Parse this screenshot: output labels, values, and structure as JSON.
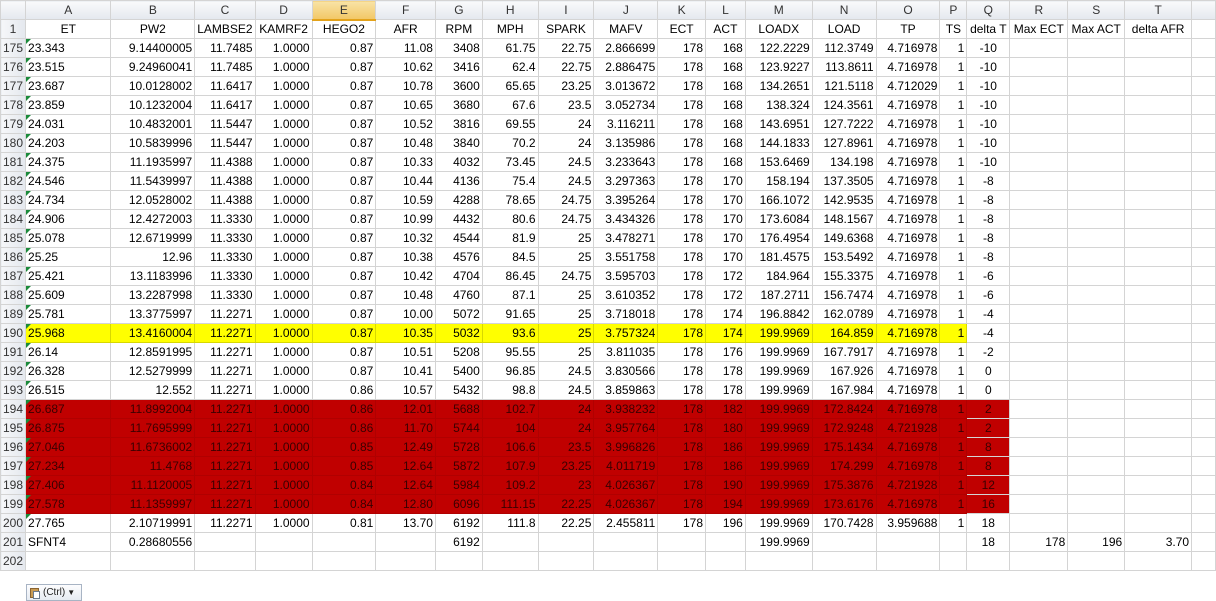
{
  "columns": [
    {
      "letter": "A",
      "header": "ET",
      "w": 86
    },
    {
      "letter": "B",
      "header": "PW2",
      "w": 84
    },
    {
      "letter": "C",
      "header": "LAMBSE2",
      "w": 60
    },
    {
      "letter": "D",
      "header": "KAMRF2",
      "w": 57
    },
    {
      "letter": "E",
      "header": "HEGO2",
      "w": 64
    },
    {
      "letter": "F",
      "header": "AFR",
      "w": 60
    },
    {
      "letter": "G",
      "header": "RPM",
      "w": 47
    },
    {
      "letter": "H",
      "header": "MPH",
      "w": 56
    },
    {
      "letter": "I",
      "header": "SPARK",
      "w": 56
    },
    {
      "letter": "J",
      "header": "MAFV",
      "w": 64
    },
    {
      "letter": "K",
      "header": "ECT",
      "w": 48
    },
    {
      "letter": "L",
      "header": "ACT",
      "w": 40
    },
    {
      "letter": "M",
      "header": "LOADX",
      "w": 67
    },
    {
      "letter": "N",
      "header": "LOAD",
      "w": 64
    },
    {
      "letter": "O",
      "header": "TP",
      "w": 64
    },
    {
      "letter": "P",
      "header": "TS",
      "w": 27
    },
    {
      "letter": "Q",
      "header": "delta T",
      "w": 43
    },
    {
      "letter": "R",
      "header": "Max ECT",
      "w": 58
    },
    {
      "letter": "S",
      "header": "Max ACT",
      "w": 57
    },
    {
      "letter": "T",
      "header": "delta AFR",
      "w": 67
    },
    {
      "letter": "",
      "header": "",
      "w": 24
    }
  ],
  "active_column": "E",
  "rows": [
    {
      "n": "175",
      "style": "",
      "cells": [
        "23.343",
        "9.14400005",
        "11.7485",
        "1.0000",
        "0.87",
        "11.08",
        "3408",
        "61.75",
        "22.75",
        "2.866699",
        "178",
        "168",
        "122.2229",
        "112.3749",
        "4.716978",
        "1",
        "-10",
        "",
        "",
        ""
      ]
    },
    {
      "n": "176",
      "style": "",
      "cells": [
        "23.515",
        "9.24960041",
        "11.7485",
        "1.0000",
        "0.87",
        "10.62",
        "3416",
        "62.4",
        "22.75",
        "2.886475",
        "178",
        "168",
        "123.9227",
        "113.8611",
        "4.716978",
        "1",
        "-10",
        "",
        "",
        ""
      ]
    },
    {
      "n": "177",
      "style": "",
      "cells": [
        "23.687",
        "10.0128002",
        "11.6417",
        "1.0000",
        "0.87",
        "10.78",
        "3600",
        "65.65",
        "23.25",
        "3.013672",
        "178",
        "168",
        "134.2651",
        "121.5118",
        "4.712029",
        "1",
        "-10",
        "",
        "",
        ""
      ]
    },
    {
      "n": "178",
      "style": "",
      "cells": [
        "23.859",
        "10.1232004",
        "11.6417",
        "1.0000",
        "0.87",
        "10.65",
        "3680",
        "67.6",
        "23.5",
        "3.052734",
        "178",
        "168",
        "138.324",
        "124.3561",
        "4.716978",
        "1",
        "-10",
        "",
        "",
        ""
      ]
    },
    {
      "n": "179",
      "style": "",
      "cells": [
        "24.031",
        "10.4832001",
        "11.5447",
        "1.0000",
        "0.87",
        "10.52",
        "3816",
        "69.55",
        "24",
        "3.116211",
        "178",
        "168",
        "143.6951",
        "127.7222",
        "4.716978",
        "1",
        "-10",
        "",
        "",
        ""
      ]
    },
    {
      "n": "180",
      "style": "",
      "cells": [
        "24.203",
        "10.5839996",
        "11.5447",
        "1.0000",
        "0.87",
        "10.48",
        "3840",
        "70.2",
        "24",
        "3.135986",
        "178",
        "168",
        "144.1833",
        "127.8961",
        "4.716978",
        "1",
        "-10",
        "",
        "",
        ""
      ]
    },
    {
      "n": "181",
      "style": "",
      "cells": [
        "24.375",
        "11.1935997",
        "11.4388",
        "1.0000",
        "0.87",
        "10.33",
        "4032",
        "73.45",
        "24.5",
        "3.233643",
        "178",
        "168",
        "153.6469",
        "134.198",
        "4.716978",
        "1",
        "-10",
        "",
        "",
        ""
      ]
    },
    {
      "n": "182",
      "style": "",
      "cells": [
        "24.546",
        "11.5439997",
        "11.4388",
        "1.0000",
        "0.87",
        "10.44",
        "4136",
        "75.4",
        "24.5",
        "3.297363",
        "178",
        "170",
        "158.194",
        "137.3505",
        "4.716978",
        "1",
        "-8",
        "",
        "",
        ""
      ]
    },
    {
      "n": "183",
      "style": "",
      "cells": [
        "24.734",
        "12.0528002",
        "11.4388",
        "1.0000",
        "0.87",
        "10.59",
        "4288",
        "78.65",
        "24.75",
        "3.395264",
        "178",
        "170",
        "166.1072",
        "142.9535",
        "4.716978",
        "1",
        "-8",
        "",
        "",
        ""
      ]
    },
    {
      "n": "184",
      "style": "",
      "cells": [
        "24.906",
        "12.4272003",
        "11.3330",
        "1.0000",
        "0.87",
        "10.99",
        "4432",
        "80.6",
        "24.75",
        "3.434326",
        "178",
        "170",
        "173.6084",
        "148.1567",
        "4.716978",
        "1",
        "-8",
        "",
        "",
        ""
      ]
    },
    {
      "n": "185",
      "style": "",
      "cells": [
        "25.078",
        "12.6719999",
        "11.3330",
        "1.0000",
        "0.87",
        "10.32",
        "4544",
        "81.9",
        "25",
        "3.478271",
        "178",
        "170",
        "176.4954",
        "149.6368",
        "4.716978",
        "1",
        "-8",
        "",
        "",
        ""
      ]
    },
    {
      "n": "186",
      "style": "",
      "cells": [
        "25.25",
        "12.96",
        "11.3330",
        "1.0000",
        "0.87",
        "10.38",
        "4576",
        "84.5",
        "25",
        "3.551758",
        "178",
        "170",
        "181.4575",
        "153.5492",
        "4.716978",
        "1",
        "-8",
        "",
        "",
        ""
      ]
    },
    {
      "n": "187",
      "style": "",
      "cells": [
        "25.421",
        "13.1183996",
        "11.3330",
        "1.0000",
        "0.87",
        "10.42",
        "4704",
        "86.45",
        "24.75",
        "3.595703",
        "178",
        "172",
        "184.964",
        "155.3375",
        "4.716978",
        "1",
        "-6",
        "",
        "",
        ""
      ]
    },
    {
      "n": "188",
      "style": "",
      "cells": [
        "25.609",
        "13.2287998",
        "11.3330",
        "1.0000",
        "0.87",
        "10.48",
        "4760",
        "87.1",
        "25",
        "3.610352",
        "178",
        "172",
        "187.2711",
        "156.7474",
        "4.716978",
        "1",
        "-6",
        "",
        "",
        ""
      ]
    },
    {
      "n": "189",
      "style": "",
      "cells": [
        "25.781",
        "13.3775997",
        "11.2271",
        "1.0000",
        "0.87",
        "10.00",
        "5072",
        "91.65",
        "25",
        "3.718018",
        "178",
        "174",
        "196.8842",
        "162.0789",
        "4.716978",
        "1",
        "-4",
        "",
        "",
        ""
      ]
    },
    {
      "n": "190",
      "style": "yellow",
      "cells": [
        "25.968",
        "13.4160004",
        "11.2271",
        "1.0000",
        "0.87",
        "10.35",
        "5032",
        "93.6",
        "25",
        "3.757324",
        "178",
        "174",
        "199.9969",
        "164.859",
        "4.716978",
        "1",
        "-4",
        "",
        "",
        ""
      ]
    },
    {
      "n": "191",
      "style": "",
      "cells": [
        "26.14",
        "12.8591995",
        "11.2271",
        "1.0000",
        "0.87",
        "10.51",
        "5208",
        "95.55",
        "25",
        "3.811035",
        "178",
        "176",
        "199.9969",
        "167.7917",
        "4.716978",
        "1",
        "-2",
        "",
        "",
        ""
      ]
    },
    {
      "n": "192",
      "style": "",
      "cells": [
        "26.328",
        "12.5279999",
        "11.2271",
        "1.0000",
        "0.87",
        "10.41",
        "5400",
        "96.85",
        "24.5",
        "3.830566",
        "178",
        "178",
        "199.9969",
        "167.926",
        "4.716978",
        "1",
        "0",
        "",
        "",
        ""
      ]
    },
    {
      "n": "193",
      "style": "",
      "cells": [
        "26.515",
        "12.552",
        "11.2271",
        "1.0000",
        "0.86",
        "10.57",
        "5432",
        "98.8",
        "24.5",
        "3.859863",
        "178",
        "178",
        "199.9969",
        "167.984",
        "4.716978",
        "1",
        "0",
        "",
        "",
        ""
      ]
    },
    {
      "n": "194",
      "style": "red",
      "cells": [
        "26.687",
        "11.8992004",
        "11.2271",
        "1.0000",
        "0.86",
        "12.01",
        "5688",
        "102.7",
        "24",
        "3.938232",
        "178",
        "182",
        "199.9969",
        "172.8424",
        "4.716978",
        "1",
        "2",
        "",
        "",
        ""
      ]
    },
    {
      "n": "195",
      "style": "red",
      "cells": [
        "26.875",
        "11.7695999",
        "11.2271",
        "1.0000",
        "0.86",
        "11.70",
        "5744",
        "104",
        "24",
        "3.957764",
        "178",
        "180",
        "199.9969",
        "172.9248",
        "4.721928",
        "1",
        "2",
        "",
        "",
        ""
      ]
    },
    {
      "n": "196",
      "style": "red",
      "cells": [
        "27.046",
        "11.6736002",
        "11.2271",
        "1.0000",
        "0.85",
        "12.49",
        "5728",
        "106.6",
        "23.5",
        "3.996826",
        "178",
        "186",
        "199.9969",
        "175.1434",
        "4.716978",
        "1",
        "8",
        "",
        "",
        ""
      ]
    },
    {
      "n": "197",
      "style": "red",
      "cells": [
        "27.234",
        "11.4768",
        "11.2271",
        "1.0000",
        "0.85",
        "12.64",
        "5872",
        "107.9",
        "23.25",
        "4.011719",
        "178",
        "186",
        "199.9969",
        "174.299",
        "4.716978",
        "1",
        "8",
        "",
        "",
        ""
      ]
    },
    {
      "n": "198",
      "style": "red",
      "cells": [
        "27.406",
        "11.1120005",
        "11.2271",
        "1.0000",
        "0.84",
        "12.64",
        "5984",
        "109.2",
        "23",
        "4.026367",
        "178",
        "190",
        "199.9969",
        "175.3876",
        "4.721928",
        "1",
        "12",
        "",
        "",
        ""
      ]
    },
    {
      "n": "199",
      "style": "red",
      "cells": [
        "27.578",
        "11.1359997",
        "11.2271",
        "1.0000",
        "0.84",
        "12.80",
        "6096",
        "111.15",
        "22.25",
        "4.026367",
        "178",
        "194",
        "199.9969",
        "173.6176",
        "4.716978",
        "1",
        "16",
        "",
        "",
        ""
      ]
    },
    {
      "n": "200",
      "style": "",
      "cells": [
        "27.765",
        "2.10719991",
        "11.2271",
        "1.0000",
        "0.81",
        "13.70",
        "6192",
        "111.8",
        "22.25",
        "2.455811",
        "178",
        "196",
        "199.9969",
        "170.7428",
        "3.959688",
        "1",
        "18",
        "",
        "",
        ""
      ]
    },
    {
      "n": "201",
      "style": "summary",
      "cells": [
        "SFNT4",
        "0.28680556",
        "",
        "",
        "",
        "",
        "6192",
        "",
        "",
        "",
        "",
        "",
        "199.9969",
        "",
        "",
        "",
        "18",
        "178",
        "196",
        "3.70"
      ]
    },
    {
      "n": "202",
      "style": "",
      "cells": [
        "",
        "",
        "",
        "",
        "",
        "",
        "",
        "",
        "",
        "",
        "",
        "",
        "",
        "",
        "",
        "",
        "",
        "",
        "",
        ""
      ]
    }
  ],
  "paste_options": {
    "label": "(Ctrl)"
  }
}
